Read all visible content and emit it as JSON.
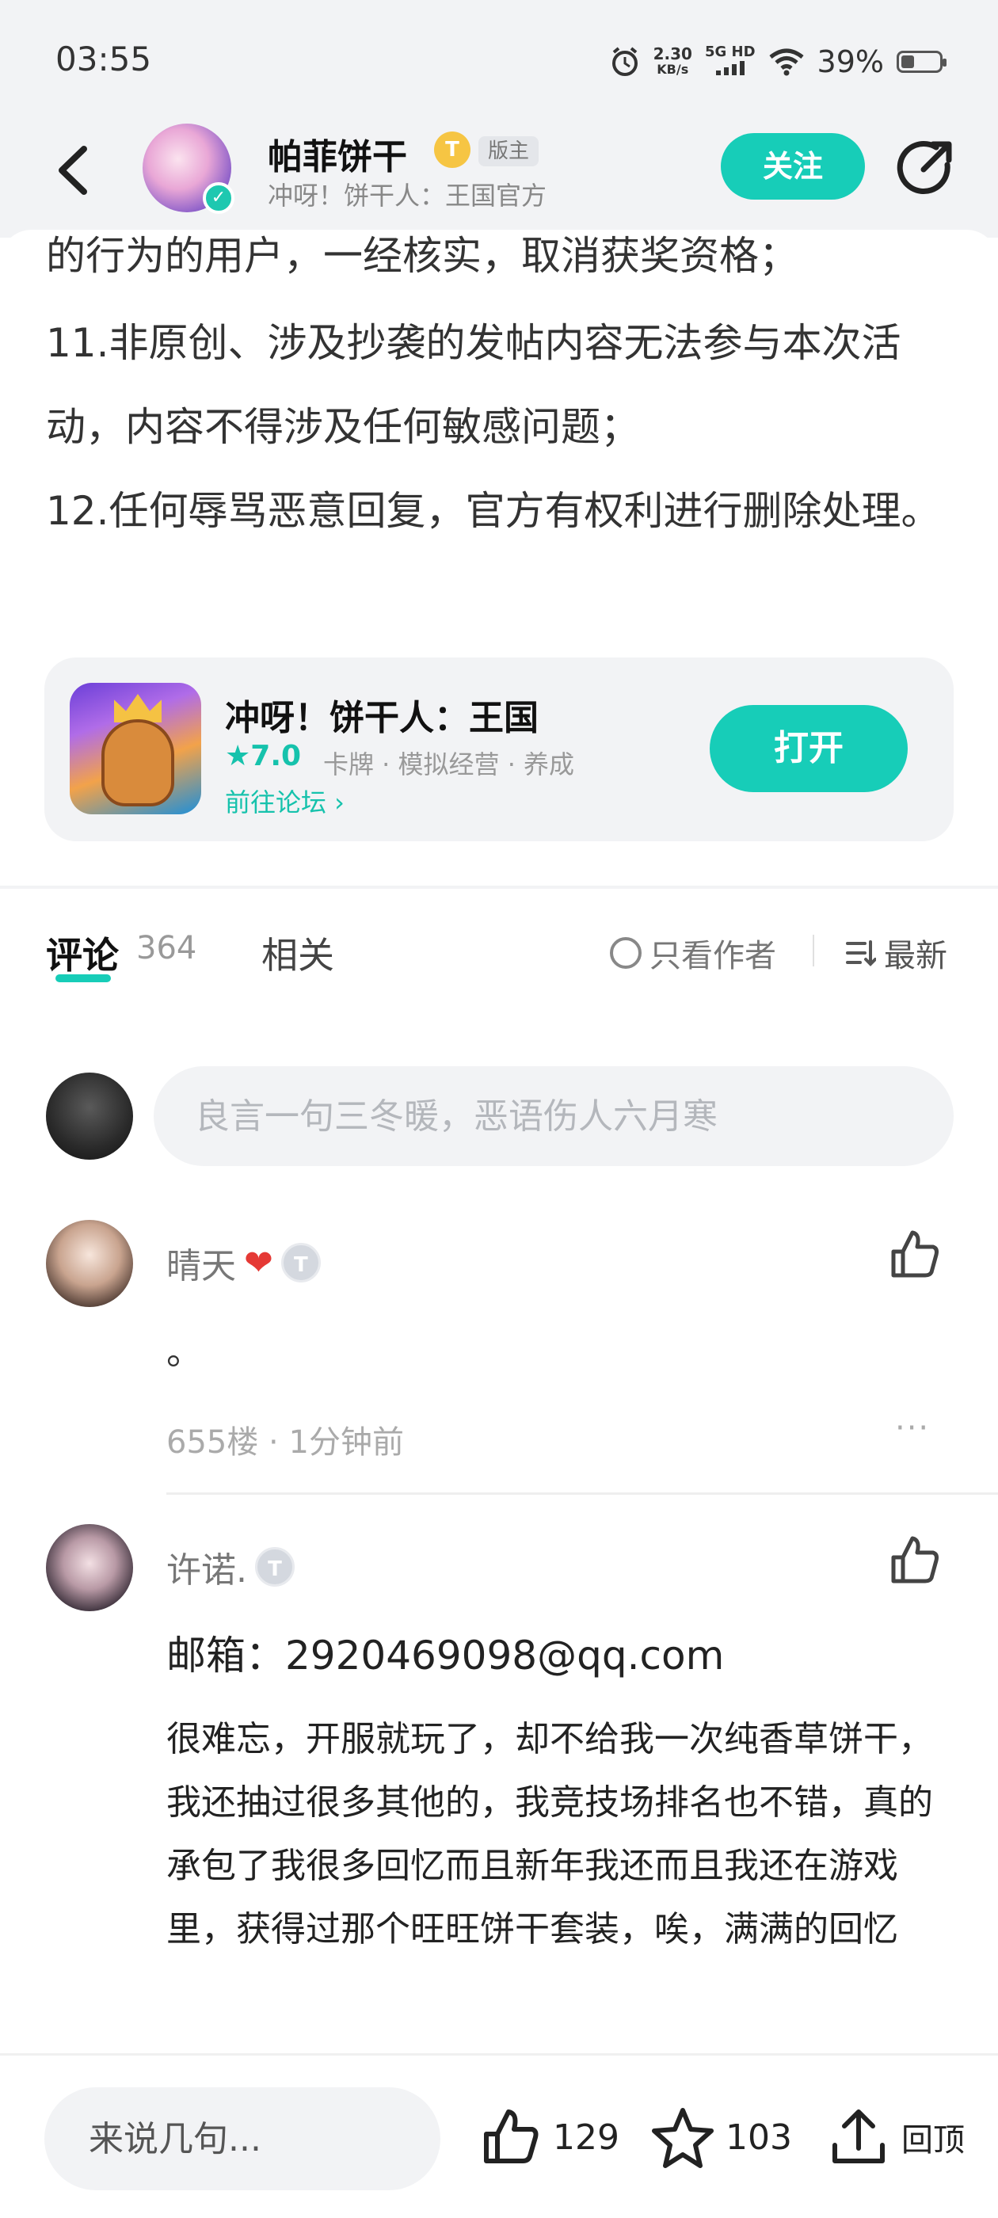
{
  "status_bar": {
    "time": "03:55",
    "net_speed_value": "2.30",
    "net_speed_unit": "KB/s",
    "network": "5G HD",
    "battery": "39%"
  },
  "header": {
    "author_name": "帕菲饼干",
    "author_badge": "T",
    "author_role": "版主",
    "author_sub": "冲呀！饼干人：王国官方",
    "follow_label": "关注"
  },
  "article": {
    "paragraphs": [
      "的行为的用户，一经核实，取消获奖资格；",
      "11.非原创、涉及抄袭的发帖内容无法参与本次活动，内容不得涉及任何敏感问题；",
      "12.任何辱骂恶意回复，官方有权利进行删除处理。"
    ]
  },
  "game_card": {
    "title": "冲呀！饼干人：王国",
    "rating": "★7.0",
    "tags": "卡牌 · 模拟经营 · 养成",
    "forum_link": "前往论坛 ›",
    "open_label": "打开"
  },
  "tabs": {
    "comment_label": "评论",
    "comment_count": "364",
    "related_label": "相关",
    "only_author_label": "只看作者",
    "sort_label": "最新"
  },
  "comment_input": {
    "placeholder": "良言一句三冬暖，恶语伤人六月寒"
  },
  "comments": [
    {
      "name": "晴天",
      "heart": "❤",
      "level": "T",
      "text": "。",
      "meta": "655楼 · 1分钟前",
      "more": "···"
    },
    {
      "name": "许诺.",
      "level": "T",
      "email_line": "邮箱：2920469098@qq.com",
      "text": "很难忘，开服就玩了，却不给我一次纯香草饼干，我还抽过很多其他的，我竞技场排名也不错，真的承包了我很多回忆而且新年我还而且我还在游戏里，获得过那个旺旺饼干套装，唉，满满的回忆"
    }
  ],
  "bottom_bar": {
    "reply_placeholder": "来说几句...",
    "like_count": "129",
    "favorite_count": "103",
    "top_label": "回顶"
  },
  "colors": {
    "accent": "#17cdb8",
    "background_gray": "#f2f3f5",
    "text_primary": "#222222",
    "text_secondary": "#999999"
  }
}
